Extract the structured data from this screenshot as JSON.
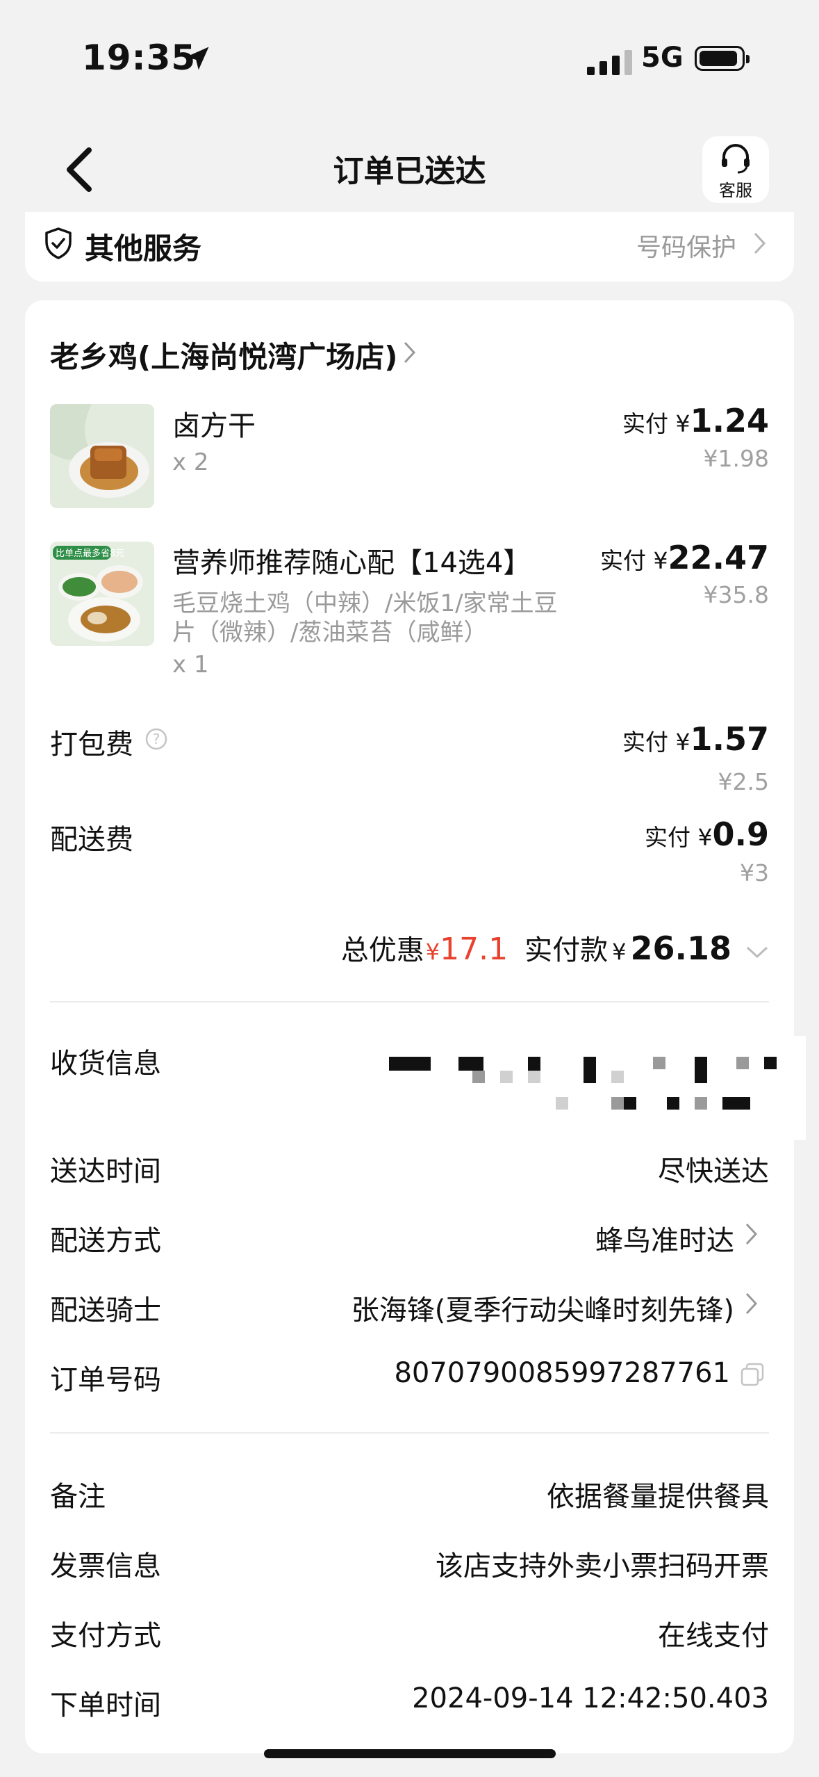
{
  "status_bar": {
    "time": "19:35",
    "network": "5G"
  },
  "header": {
    "title": "订单已送达",
    "cs_label": "客服"
  },
  "services": {
    "title": "其他服务",
    "right": "号码保护"
  },
  "shop": {
    "name": "老乡鸡(上海尚悦湾广场店)"
  },
  "items": [
    {
      "name": "卤方干",
      "qty": "x 2",
      "pay_label": "实付 ¥",
      "pay_value": "1.24",
      "original": "¥1.98"
    },
    {
      "name": "营养师推荐随心配【14选4】",
      "spec_line1": "毛豆烧土鸡（中辣）/米饭1/家常土豆",
      "spec_line2": "片（微辣）/葱油菜苔（咸鲜）",
      "qty": "x 1",
      "pay_label": "实付 ¥",
      "pay_value": "22.47",
      "original": "¥35.8",
      "promo_badge": "比单点最多省8元"
    }
  ],
  "fees": [
    {
      "label": "打包费",
      "pay_label": "实付 ¥",
      "pay_value": "1.57",
      "original": "¥2.5"
    },
    {
      "label": "配送费",
      "pay_label": "实付 ¥",
      "pay_value": "0.9",
      "original": "¥3"
    }
  ],
  "summary": {
    "discount_label": "总优惠",
    "discount_currency": "¥",
    "discount_value": "17.1",
    "paid_label": "实付款",
    "paid_currency": "¥",
    "paid_value": "26.18"
  },
  "info": {
    "receiver_label": "收货信息",
    "delivery_time_label": "送达时间",
    "delivery_time_value": "尽快送达",
    "delivery_method_label": "配送方式",
    "delivery_method_value": "蜂鸟准时达",
    "rider_label": "配送骑士",
    "rider_value": "张海锋(夏季行动尖峰时刻先锋)",
    "order_no_label": "订单号码",
    "order_no_value": "8070790085997287761"
  },
  "extra": {
    "note_label": "备注",
    "note_value": "依据餐量提供餐具",
    "invoice_label": "发票信息",
    "invoice_value": "该店支持外卖小票扫码开票",
    "payment_label": "支付方式",
    "payment_value": "在线支付",
    "order_time_label": "下单时间",
    "order_time_value": "2024-09-14 12:42:50.403"
  },
  "colors": {
    "accent_red": "#e8412c",
    "muted": "#9a9a9a"
  }
}
